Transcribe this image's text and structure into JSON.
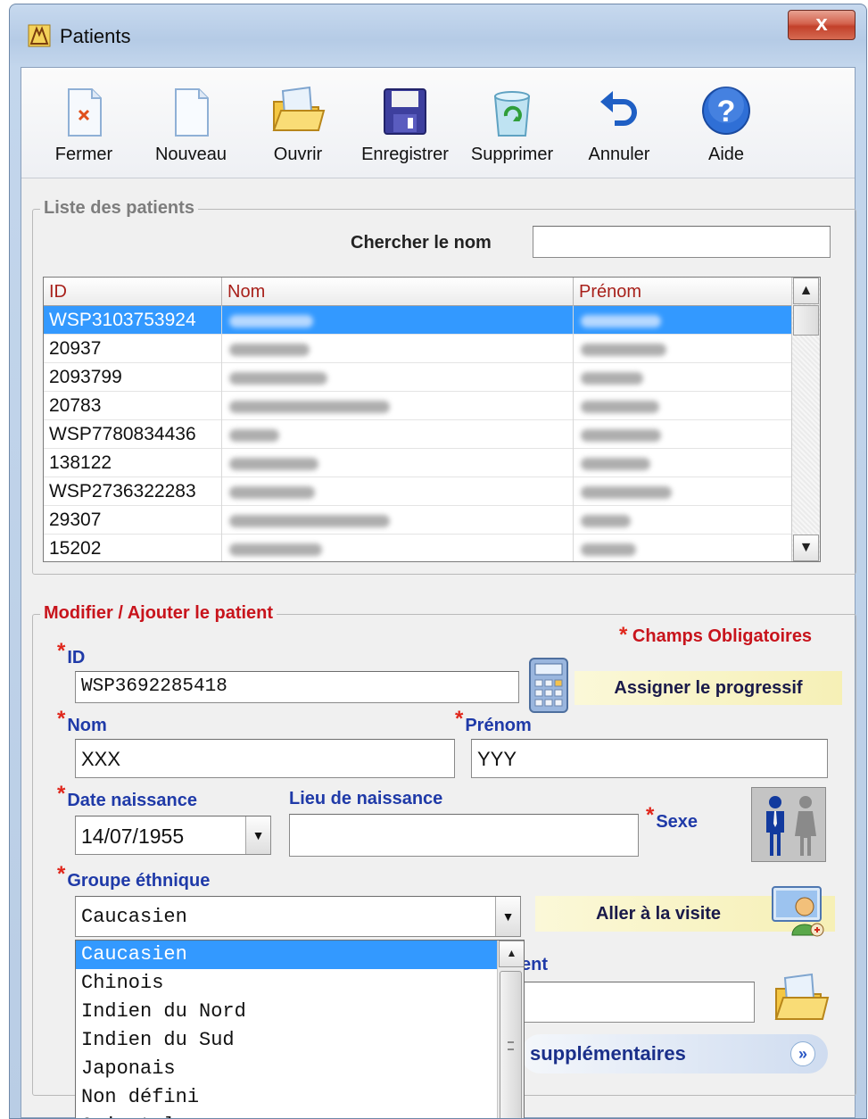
{
  "window": {
    "title": "Patients",
    "close_glyph": "x"
  },
  "toolbar": {
    "items": [
      {
        "label": "Fermer",
        "icon": "close-document-icon"
      },
      {
        "label": "Nouveau",
        "icon": "new-document-icon"
      },
      {
        "label": "Ouvrir",
        "icon": "open-folder-icon"
      },
      {
        "label": "Enregistrer",
        "icon": "floppy-disk-icon"
      },
      {
        "label": "Supprimer",
        "icon": "recycle-bin-icon"
      },
      {
        "label": "Annuler",
        "icon": "undo-icon"
      },
      {
        "label": "Aide",
        "icon": "help-icon"
      }
    ]
  },
  "patient_list": {
    "legend": "Liste des patients",
    "search_label": "Chercher le nom",
    "search_value": "",
    "columns": [
      "ID",
      "Nom",
      "Prénom"
    ],
    "rows": [
      {
        "id": "WSP3103753924",
        "nom": "",
        "prenom": "",
        "selected": true
      },
      {
        "id": "20937",
        "nom": "",
        "prenom": ""
      },
      {
        "id": "2093799",
        "nom": "",
        "prenom": ""
      },
      {
        "id": "20783",
        "nom": "",
        "prenom": ""
      },
      {
        "id": "WSP7780834436",
        "nom": "",
        "prenom": ""
      },
      {
        "id": "138122",
        "nom": "",
        "prenom": ""
      },
      {
        "id": "WSP2736322283",
        "nom": "",
        "prenom": ""
      },
      {
        "id": "29307",
        "nom": "",
        "prenom": ""
      },
      {
        "id": "15202",
        "nom": "",
        "prenom": ""
      }
    ]
  },
  "edit_form": {
    "legend": "Modifier / Ajouter le patient",
    "mandatory_note": "Champs Obligatoires",
    "required_mark": "*",
    "id_label": "ID",
    "id_value": "WSP3692285418",
    "assign_button": "Assigner le progressif",
    "nom_label": "Nom",
    "nom_value": "XXX",
    "prenom_label": "Prénom",
    "prenom_value": "YYY",
    "date_label": "Date naissance",
    "date_value": "14/07/1955",
    "lieu_label": "Lieu de naissance",
    "lieu_value": "",
    "sexe_label": "Sexe",
    "groupe_label": "Groupe éthnique",
    "groupe_value": "Caucasien",
    "visit_button": "Aller à la visite",
    "partial_label": "ent",
    "more_button": "supplémentaires",
    "more_glyph": "»"
  },
  "ethnic_dropdown": {
    "options": [
      "Caucasien",
      "Chinois",
      "Indien du Nord",
      "Indien du Sud",
      "Japonais",
      "Non défini",
      "Oriental"
    ],
    "selected": "Caucasien"
  },
  "colors": {
    "legend_red": "#c8141c",
    "label_blue": "#1f3aa8",
    "selection": "#3399ff",
    "column_header": "#a8201a"
  }
}
